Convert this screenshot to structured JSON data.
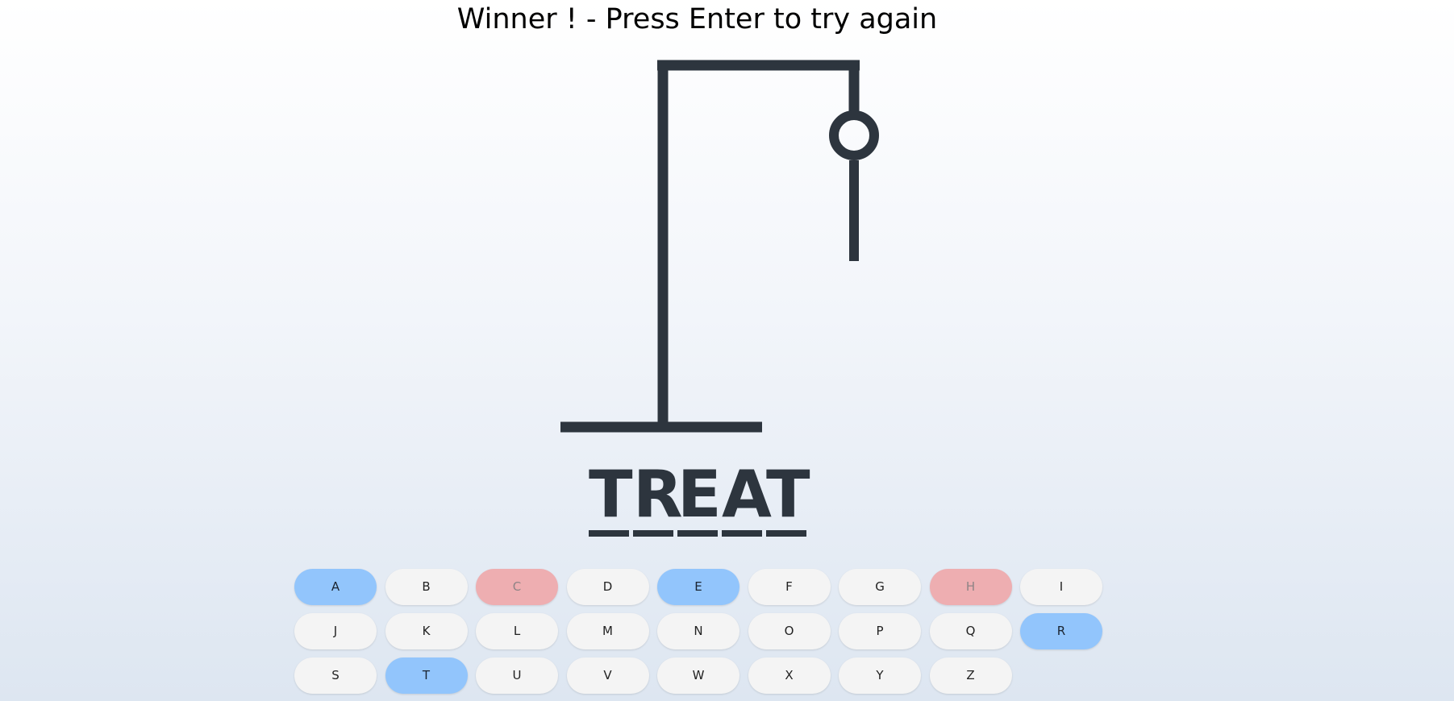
{
  "status": {
    "message": "Winner ! - Press Enter to try again"
  },
  "hangman": {
    "parts_shown": [
      "head",
      "body"
    ],
    "stroke_color": "#2d353e"
  },
  "word": {
    "letters": [
      "T",
      "R",
      "E",
      "A",
      "T"
    ]
  },
  "keyboard": {
    "keys": [
      {
        "label": "A",
        "state": "correct"
      },
      {
        "label": "B",
        "state": "unused"
      },
      {
        "label": "C",
        "state": "wrong"
      },
      {
        "label": "D",
        "state": "unused"
      },
      {
        "label": "E",
        "state": "correct"
      },
      {
        "label": "F",
        "state": "unused"
      },
      {
        "label": "G",
        "state": "unused"
      },
      {
        "label": "H",
        "state": "wrong"
      },
      {
        "label": "I",
        "state": "unused"
      },
      {
        "label": "J",
        "state": "unused"
      },
      {
        "label": "K",
        "state": "unused"
      },
      {
        "label": "L",
        "state": "unused"
      },
      {
        "label": "M",
        "state": "unused"
      },
      {
        "label": "N",
        "state": "unused"
      },
      {
        "label": "O",
        "state": "unused"
      },
      {
        "label": "P",
        "state": "unused"
      },
      {
        "label": "Q",
        "state": "unused"
      },
      {
        "label": "R",
        "state": "correct"
      },
      {
        "label": "S",
        "state": "unused"
      },
      {
        "label": "T",
        "state": "correct"
      },
      {
        "label": "U",
        "state": "unused"
      },
      {
        "label": "V",
        "state": "unused"
      },
      {
        "label": "W",
        "state": "unused"
      },
      {
        "label": "X",
        "state": "unused"
      },
      {
        "label": "Y",
        "state": "unused"
      },
      {
        "label": "Z",
        "state": "unused"
      }
    ]
  },
  "colors": {
    "correct": "#92c5fc",
    "wrong": "#eeaeb1",
    "unused": "#f4f4f4",
    "ink": "#2d353e"
  }
}
